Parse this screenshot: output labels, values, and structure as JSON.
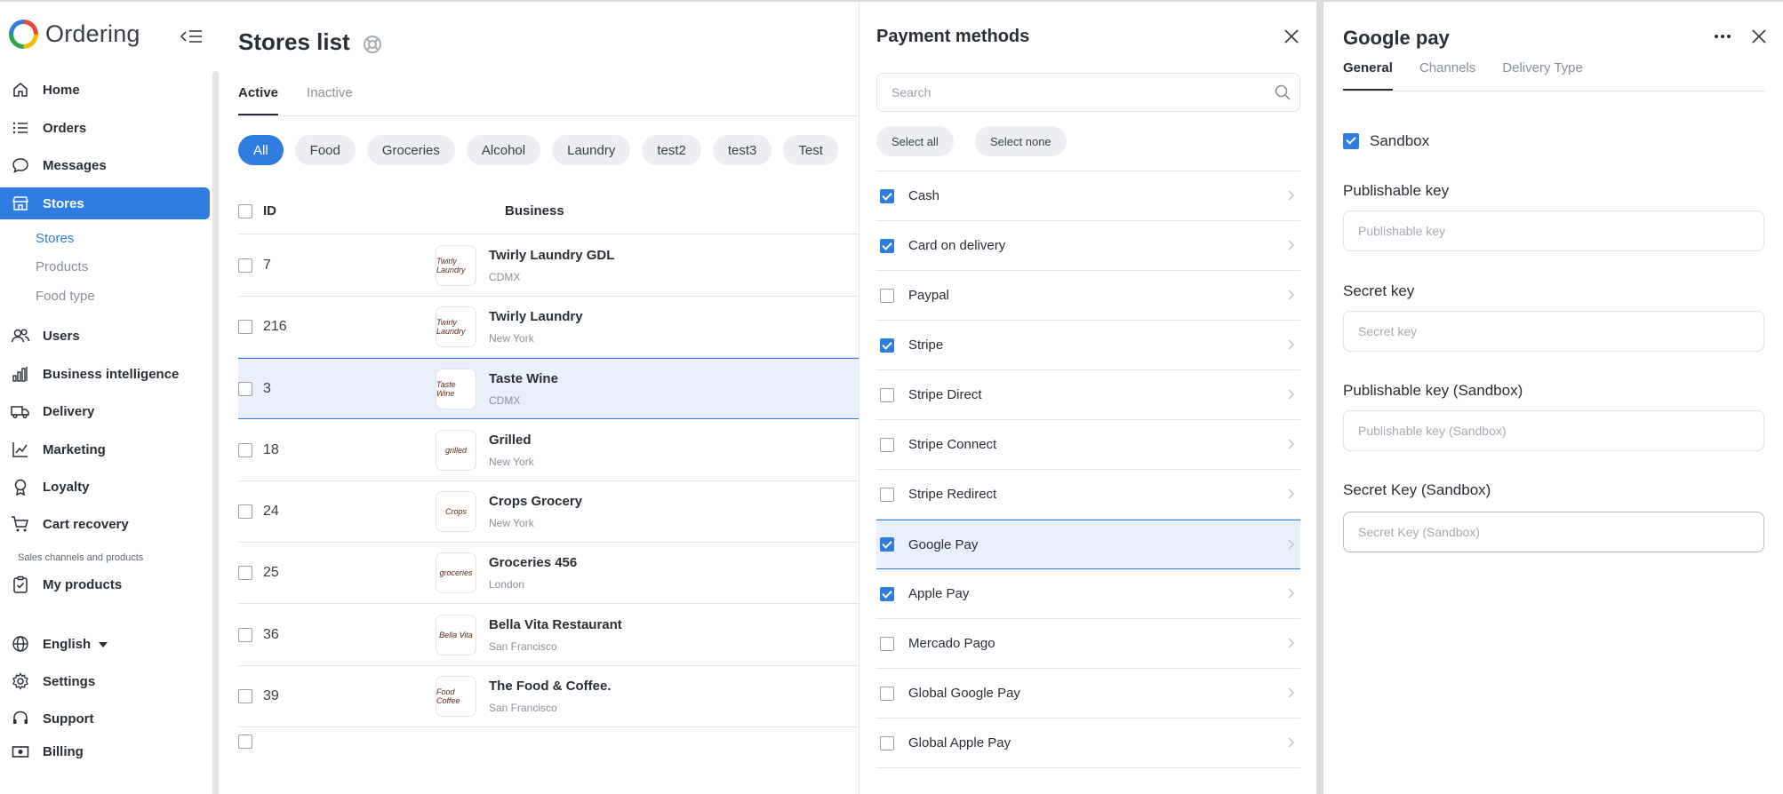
{
  "app": {
    "name": "Ordering"
  },
  "sidebar": {
    "items": [
      {
        "label": "Home",
        "icon": "home-icon"
      },
      {
        "label": "Orders",
        "icon": "list-icon"
      },
      {
        "label": "Messages",
        "icon": "chat-icon"
      },
      {
        "label": "Stores",
        "icon": "store-icon"
      },
      {
        "label": "Users",
        "icon": "users-icon"
      },
      {
        "label": "Business intelligence",
        "icon": "bar-chart-icon"
      },
      {
        "label": "Delivery",
        "icon": "truck-icon"
      },
      {
        "label": "Marketing",
        "icon": "trend-icon"
      },
      {
        "label": "Loyalty",
        "icon": "award-icon"
      },
      {
        "label": "Cart recovery",
        "icon": "cart-icon"
      },
      {
        "label": "My products",
        "icon": "clipboard-icon"
      },
      {
        "label": "English",
        "icon": "globe-icon"
      },
      {
        "label": "Settings",
        "icon": "gear-icon"
      },
      {
        "label": "Support",
        "icon": "headset-icon"
      },
      {
        "label": "Billing",
        "icon": "cash-icon"
      }
    ],
    "sub_items": [
      "Stores",
      "Products",
      "Food type"
    ],
    "section_label": "Sales channels and products",
    "accent": "#2f7de1"
  },
  "main": {
    "title": "Stores list",
    "tabs": [
      "Active",
      "Inactive"
    ],
    "chips": [
      "All",
      "Food",
      "Groceries",
      "Alcohol",
      "Laundry",
      "test2",
      "test3",
      "Test"
    ],
    "columns": {
      "id": "ID",
      "business": "Business"
    },
    "rows": [
      {
        "id": "7",
        "name": "Twirly Laundry GDL",
        "city": "CDMX",
        "logo": "Twirly Laundry"
      },
      {
        "id": "216",
        "name": "Twirly Laundry",
        "city": "New York",
        "logo": "Twirly Laundry"
      },
      {
        "id": "3",
        "name": "Taste Wine",
        "city": "CDMX",
        "logo": "Taste Wine"
      },
      {
        "id": "18",
        "name": "Grilled",
        "city": "New York",
        "logo": "grilled"
      },
      {
        "id": "24",
        "name": "Crops Grocery",
        "city": "New York",
        "logo": "Crops"
      },
      {
        "id": "25",
        "name": "Groceries 456",
        "city": "London",
        "logo": "groceries"
      },
      {
        "id": "36",
        "name": "Bella Vita Restaurant",
        "city": "San Francisco",
        "logo": "Bella Vita"
      },
      {
        "id": "39",
        "name": "The Food & Coffee.",
        "city": "San Francisco",
        "logo": "Food Coffee"
      }
    ]
  },
  "payment": {
    "title": "Payment methods",
    "search_placeholder": "Search",
    "select_all": "Select all",
    "select_none": "Select none",
    "methods": [
      {
        "label": "Cash",
        "checked": true
      },
      {
        "label": "Card on delivery",
        "checked": true
      },
      {
        "label": "Paypal",
        "checked": false
      },
      {
        "label": "Stripe",
        "checked": true
      },
      {
        "label": "Stripe Direct",
        "checked": false
      },
      {
        "label": "Stripe Connect",
        "checked": false
      },
      {
        "label": "Stripe Redirect",
        "checked": false
      },
      {
        "label": "Google Pay",
        "checked": true
      },
      {
        "label": "Apple Pay",
        "checked": true
      },
      {
        "label": "Mercado Pago",
        "checked": false
      },
      {
        "label": "Global Google Pay",
        "checked": false
      },
      {
        "label": "Global Apple Pay",
        "checked": false
      }
    ]
  },
  "gpay": {
    "title": "Google pay",
    "tabs": [
      "General",
      "Channels",
      "Delivery Type"
    ],
    "sandbox_label": "Sandbox",
    "fields": [
      {
        "label": "Publishable key",
        "placeholder": "Publishable key"
      },
      {
        "label": "Secret key",
        "placeholder": "Secret key"
      },
      {
        "label": "Publishable key (Sandbox)",
        "placeholder": "Publishable key (Sandbox)"
      },
      {
        "label": "Secret Key (Sandbox)",
        "placeholder": "Secret Key (Sandbox)"
      }
    ]
  }
}
